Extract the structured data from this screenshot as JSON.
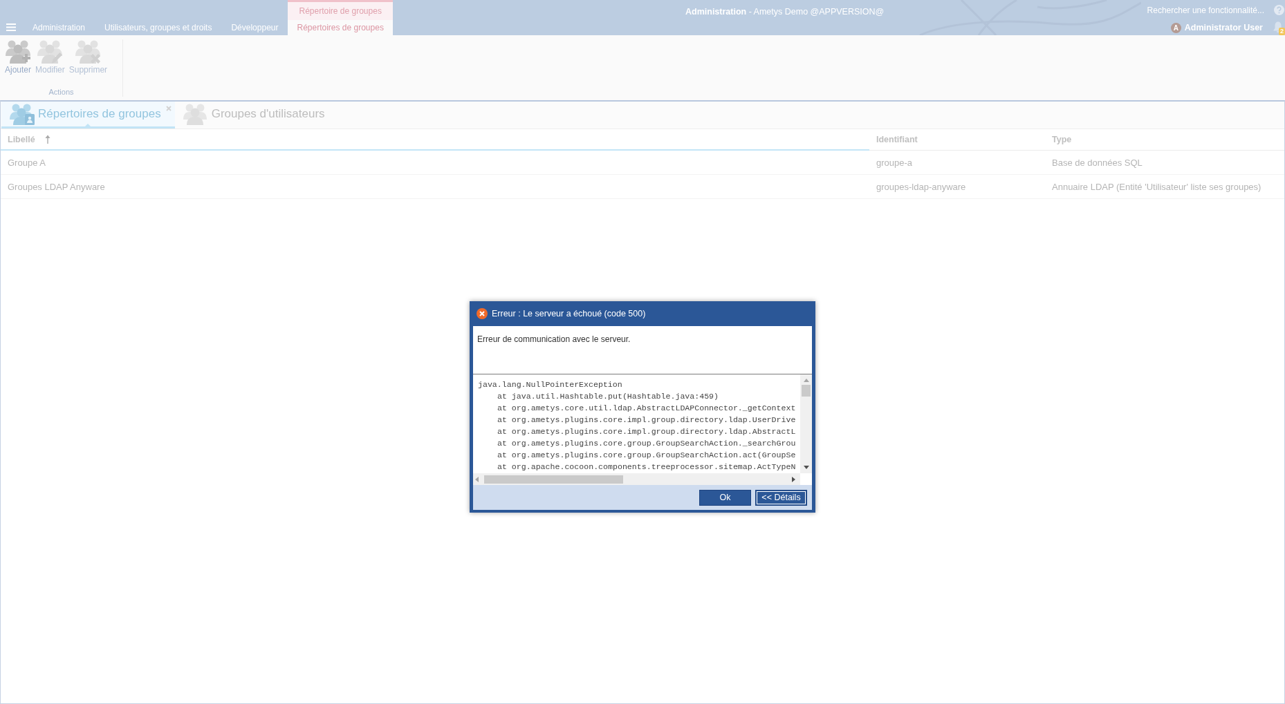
{
  "topbar": {
    "menu_tabs": [
      {
        "label": "Administration",
        "selected": false
      },
      {
        "label": "Utilisateurs, groupes et droits",
        "selected": false
      },
      {
        "label": "Développeur",
        "selected": false
      }
    ],
    "contextual_group": {
      "label": "Répertoire de groupes",
      "tabs": [
        {
          "label": "Répertoires de groupes",
          "selected": true
        }
      ]
    },
    "title": "**Administration** - Ametys Demo @APPVERSION@",
    "search": {
      "placeholder": "Rechercher une fonctionnalité..."
    },
    "user": {
      "initial": "A",
      "name": "Administrator User"
    },
    "notifications": {
      "count": "2"
    }
  },
  "ribbon": {
    "groups": [
      {
        "label": "Actions",
        "buttons": [
          {
            "label": "Ajouter",
            "kind": "add",
            "disabled": false
          },
          {
            "label": "Modifier",
            "kind": "edit",
            "disabled": true
          },
          {
            "label": "Supprimer",
            "kind": "delete",
            "disabled": true
          }
        ]
      }
    ]
  },
  "panel_tabs": [
    {
      "label": "Répertoires de groupes",
      "kind": "directory",
      "selected": true,
      "closable": true
    },
    {
      "label": "Groupes d'utilisateurs",
      "kind": "groups",
      "selected": false,
      "closable": false
    }
  ],
  "table": {
    "columns": [
      {
        "label": "Libellé",
        "sorted": true
      },
      {
        "label": "Identifiant",
        "sorted": false
      },
      {
        "label": "Type",
        "sorted": false
      }
    ],
    "rows": [
      {
        "cells": [
          "Groupe A",
          "groupe-a",
          "Base de données SQL"
        ],
        "selected": false
      },
      {
        "cells": [
          "Groupes LDAP Anyware",
          "groupes-ldap-anyware",
          "Annuaire LDAP (Entité 'Utilisateur' liste ses groupes)"
        ],
        "selected": false
      }
    ]
  },
  "dialog": {
    "kind": "error",
    "title": "Erreur : Le serveur a échoué (code 500)",
    "message": "Erreur de communication avec le serveur.",
    "details": {
      "exception": "java.lang.NullPointerException",
      "frames": [
        "at java.util.Hashtable.put(Hashtable.java:459)",
        "at org.ametys.core.util.ldap.AbstractLDAPConnector._getContext",
        "at org.ametys.plugins.core.impl.group.directory.ldap.UserDrive",
        "at org.ametys.plugins.core.impl.group.directory.ldap.AbstractL",
        "at org.ametys.plugins.core.group.GroupSearchAction._searchGrou",
        "at org.ametys.plugins.core.group.GroupSearchAction.act(GroupSe",
        "at org.apache.cocoon.components.treeprocessor.sitemap.ActTypeN"
      ]
    },
    "buttons": [
      {
        "label": "Ok",
        "focused": false
      },
      {
        "label": "<< Détails",
        "focused": true
      }
    ]
  }
}
